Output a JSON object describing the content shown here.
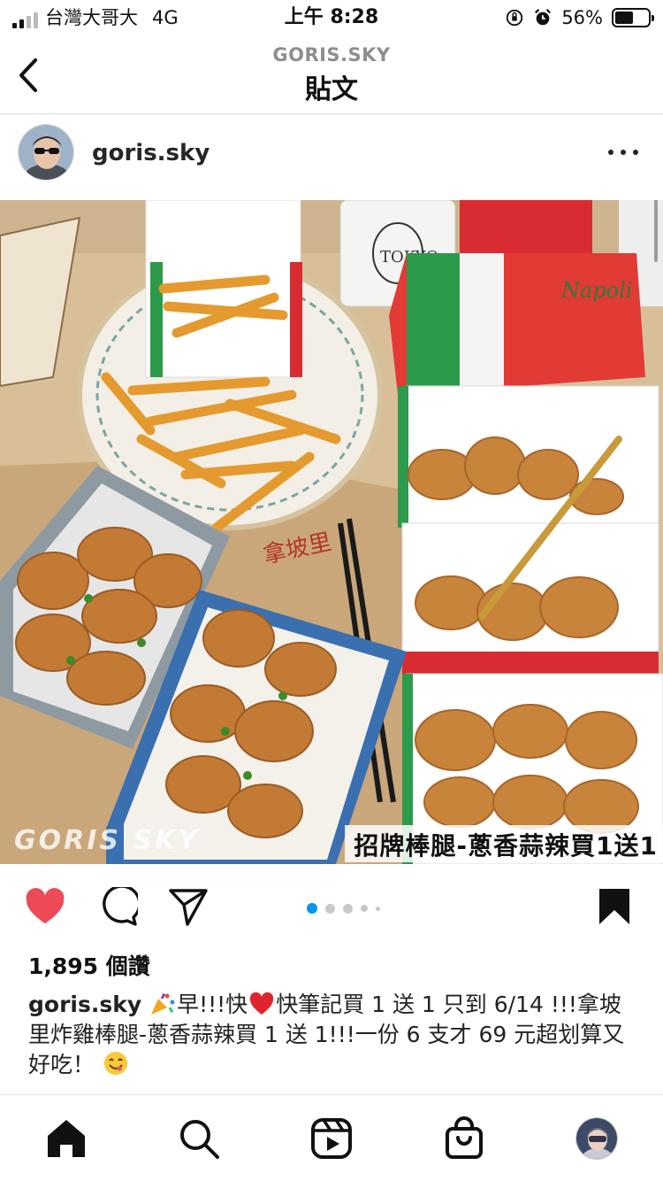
{
  "status_bar": {
    "carrier": "台灣大哥大",
    "network": "4G",
    "time": "上午 8:28",
    "battery": "56%",
    "battery_level": 0.56
  },
  "nav": {
    "subtitle": "GORIS.SKY",
    "title": "貼文"
  },
  "post": {
    "username": "goris.sky",
    "photo_overlay_text": "招牌棒腿-蔥香蒜辣買1送1",
    "photo_watermark": "GORIS SKY",
    "photo_labels": {
      "box_brand": "Napoli",
      "candle_brand": "TOKYO",
      "paper_text": "拿坡里"
    },
    "carousel": {
      "count": 5,
      "active_index": 0
    },
    "likes": "1,895 個讚",
    "caption_user": "goris.sky",
    "caption_parts": {
      "part1": "早!!!快",
      "part2": "快筆記買 1 送 1 只到 6/14 !!!拿坡里炸雞棒腿-蔥香蒜辣買 1 送 1!!!一份 6 支才 69 元超划算又好吃！"
    }
  },
  "icons": {
    "like": "heart-icon",
    "comment": "comment-icon",
    "share": "share-icon",
    "save": "bookmark-icon",
    "tabs": [
      "home-icon",
      "search-icon",
      "reels-icon",
      "shop-icon",
      "profile-avatar"
    ]
  },
  "colors": {
    "like_red": "#ed4956",
    "carousel_active": "#0095f6",
    "text": "#262626",
    "muted": "#8e8e8e"
  }
}
